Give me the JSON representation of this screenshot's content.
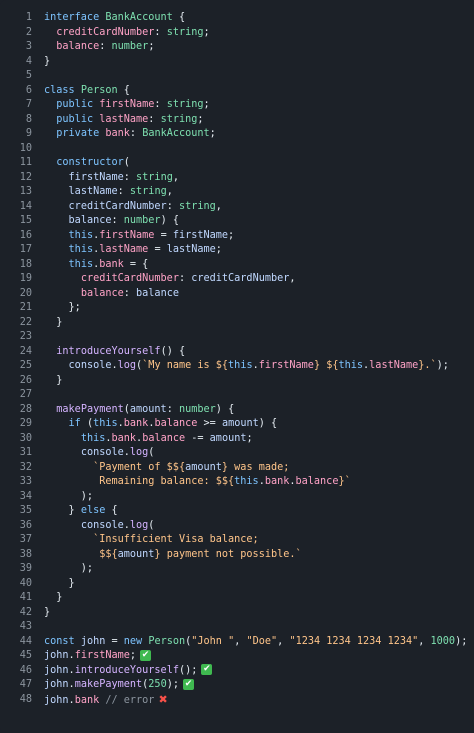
{
  "editor": {
    "lines": [
      [
        {
          "t": "interface ",
          "c": "k"
        },
        {
          "t": "BankAccount",
          "c": "t"
        },
        {
          "t": " {",
          "c": "tx"
        }
      ],
      [
        {
          "t": "  ",
          "c": "tx"
        },
        {
          "t": "creditCardNumber",
          "c": "p"
        },
        {
          "t": ": ",
          "c": "tx"
        },
        {
          "t": "string",
          "c": "t"
        },
        {
          "t": ";",
          "c": "tx"
        }
      ],
      [
        {
          "t": "  ",
          "c": "tx"
        },
        {
          "t": "balance",
          "c": "p"
        },
        {
          "t": ": ",
          "c": "tx"
        },
        {
          "t": "number",
          "c": "t"
        },
        {
          "t": ";",
          "c": "tx"
        }
      ],
      [
        {
          "t": "}",
          "c": "tx"
        }
      ],
      [],
      [
        {
          "t": "class ",
          "c": "k"
        },
        {
          "t": "Person",
          "c": "t"
        },
        {
          "t": " {",
          "c": "tx"
        }
      ],
      [
        {
          "t": "  ",
          "c": "tx"
        },
        {
          "t": "public ",
          "c": "k"
        },
        {
          "t": "firstName",
          "c": "p"
        },
        {
          "t": ": ",
          "c": "tx"
        },
        {
          "t": "string",
          "c": "t"
        },
        {
          "t": ";",
          "c": "tx"
        }
      ],
      [
        {
          "t": "  ",
          "c": "tx"
        },
        {
          "t": "public ",
          "c": "k"
        },
        {
          "t": "lastName",
          "c": "p"
        },
        {
          "t": ": ",
          "c": "tx"
        },
        {
          "t": "string",
          "c": "t"
        },
        {
          "t": ";",
          "c": "tx"
        }
      ],
      [
        {
          "t": "  ",
          "c": "tx"
        },
        {
          "t": "private ",
          "c": "k"
        },
        {
          "t": "bank",
          "c": "p"
        },
        {
          "t": ": ",
          "c": "tx"
        },
        {
          "t": "BankAccount",
          "c": "t"
        },
        {
          "t": ";",
          "c": "tx"
        }
      ],
      [],
      [
        {
          "t": "  ",
          "c": "tx"
        },
        {
          "t": "constructor",
          "c": "k"
        },
        {
          "t": "(",
          "c": "tx"
        }
      ],
      [
        {
          "t": "    ",
          "c": "tx"
        },
        {
          "t": "firstName",
          "c": "v"
        },
        {
          "t": ": ",
          "c": "tx"
        },
        {
          "t": "string",
          "c": "t"
        },
        {
          "t": ",",
          "c": "tx"
        }
      ],
      [
        {
          "t": "    ",
          "c": "tx"
        },
        {
          "t": "lastName",
          "c": "v"
        },
        {
          "t": ": ",
          "c": "tx"
        },
        {
          "t": "string",
          "c": "t"
        },
        {
          "t": ",",
          "c": "tx"
        }
      ],
      [
        {
          "t": "    ",
          "c": "tx"
        },
        {
          "t": "creditCardNumber",
          "c": "v"
        },
        {
          "t": ": ",
          "c": "tx"
        },
        {
          "t": "string",
          "c": "t"
        },
        {
          "t": ",",
          "c": "tx"
        }
      ],
      [
        {
          "t": "    ",
          "c": "tx"
        },
        {
          "t": "balance",
          "c": "v"
        },
        {
          "t": ": ",
          "c": "tx"
        },
        {
          "t": "number",
          "c": "t"
        },
        {
          "t": ") {",
          "c": "tx"
        }
      ],
      [
        {
          "t": "    ",
          "c": "tx"
        },
        {
          "t": "this",
          "c": "k"
        },
        {
          "t": ".",
          "c": "tx"
        },
        {
          "t": "firstName",
          "c": "p"
        },
        {
          "t": " = ",
          "c": "tx"
        },
        {
          "t": "firstName",
          "c": "v"
        },
        {
          "t": ";",
          "c": "tx"
        }
      ],
      [
        {
          "t": "    ",
          "c": "tx"
        },
        {
          "t": "this",
          "c": "k"
        },
        {
          "t": ".",
          "c": "tx"
        },
        {
          "t": "lastName",
          "c": "p"
        },
        {
          "t": " = ",
          "c": "tx"
        },
        {
          "t": "lastName",
          "c": "v"
        },
        {
          "t": ";",
          "c": "tx"
        }
      ],
      [
        {
          "t": "    ",
          "c": "tx"
        },
        {
          "t": "this",
          "c": "k"
        },
        {
          "t": ".",
          "c": "tx"
        },
        {
          "t": "bank",
          "c": "p"
        },
        {
          "t": " = {",
          "c": "tx"
        }
      ],
      [
        {
          "t": "      ",
          "c": "tx"
        },
        {
          "t": "creditCardNumber",
          "c": "p"
        },
        {
          "t": ": ",
          "c": "tx"
        },
        {
          "t": "creditCardNumber",
          "c": "v"
        },
        {
          "t": ",",
          "c": "tx"
        }
      ],
      [
        {
          "t": "      ",
          "c": "tx"
        },
        {
          "t": "balance",
          "c": "p"
        },
        {
          "t": ": ",
          "c": "tx"
        },
        {
          "t": "balance",
          "c": "v"
        }
      ],
      [
        {
          "t": "    };",
          "c": "tx"
        }
      ],
      [
        {
          "t": "  }",
          "c": "tx"
        }
      ],
      [],
      [
        {
          "t": "  ",
          "c": "tx"
        },
        {
          "t": "introduceYourself",
          "c": "f"
        },
        {
          "t": "() {",
          "c": "tx"
        }
      ],
      [
        {
          "t": "    ",
          "c": "tx"
        },
        {
          "t": "console",
          "c": "v"
        },
        {
          "t": ".",
          "c": "tx"
        },
        {
          "t": "log",
          "c": "f"
        },
        {
          "t": "(",
          "c": "tx"
        },
        {
          "t": "`My name is ${",
          "c": "s"
        },
        {
          "t": "this",
          "c": "k"
        },
        {
          "t": ".",
          "c": "tx"
        },
        {
          "t": "firstName",
          "c": "p"
        },
        {
          "t": "} ${",
          "c": "s"
        },
        {
          "t": "this",
          "c": "k"
        },
        {
          "t": ".",
          "c": "tx"
        },
        {
          "t": "lastName",
          "c": "p"
        },
        {
          "t": "}.`",
          "c": "s"
        },
        {
          "t": ");",
          "c": "tx"
        }
      ],
      [
        {
          "t": "  }",
          "c": "tx"
        }
      ],
      [],
      [
        {
          "t": "  ",
          "c": "tx"
        },
        {
          "t": "makePayment",
          "c": "f"
        },
        {
          "t": "(",
          "c": "tx"
        },
        {
          "t": "amount",
          "c": "v"
        },
        {
          "t": ": ",
          "c": "tx"
        },
        {
          "t": "number",
          "c": "t"
        },
        {
          "t": ") {",
          "c": "tx"
        }
      ],
      [
        {
          "t": "    ",
          "c": "tx"
        },
        {
          "t": "if ",
          "c": "k"
        },
        {
          "t": "(",
          "c": "tx"
        },
        {
          "t": "this",
          "c": "k"
        },
        {
          "t": ".",
          "c": "tx"
        },
        {
          "t": "bank",
          "c": "p"
        },
        {
          "t": ".",
          "c": "tx"
        },
        {
          "t": "balance",
          "c": "p"
        },
        {
          "t": " >= ",
          "c": "tx"
        },
        {
          "t": "amount",
          "c": "v"
        },
        {
          "t": ") {",
          "c": "tx"
        }
      ],
      [
        {
          "t": "      ",
          "c": "tx"
        },
        {
          "t": "this",
          "c": "k"
        },
        {
          "t": ".",
          "c": "tx"
        },
        {
          "t": "bank",
          "c": "p"
        },
        {
          "t": ".",
          "c": "tx"
        },
        {
          "t": "balance",
          "c": "p"
        },
        {
          "t": " -= ",
          "c": "tx"
        },
        {
          "t": "amount",
          "c": "v"
        },
        {
          "t": ";",
          "c": "tx"
        }
      ],
      [
        {
          "t": "      ",
          "c": "tx"
        },
        {
          "t": "console",
          "c": "v"
        },
        {
          "t": ".",
          "c": "tx"
        },
        {
          "t": "log",
          "c": "f"
        },
        {
          "t": "(",
          "c": "tx"
        }
      ],
      [
        {
          "t": "        ",
          "c": "tx"
        },
        {
          "t": "`Payment of $${",
          "c": "s"
        },
        {
          "t": "amount",
          "c": "v"
        },
        {
          "t": "} was made;",
          "c": "s"
        }
      ],
      [
        {
          "t": "         ",
          "c": "tx"
        },
        {
          "t": "Remaining balance: $${",
          "c": "s"
        },
        {
          "t": "this",
          "c": "k"
        },
        {
          "t": ".",
          "c": "tx"
        },
        {
          "t": "bank",
          "c": "p"
        },
        {
          "t": ".",
          "c": "tx"
        },
        {
          "t": "balance",
          "c": "p"
        },
        {
          "t": "}`",
          "c": "s"
        }
      ],
      [
        {
          "t": "      );",
          "c": "tx"
        }
      ],
      [
        {
          "t": "    } ",
          "c": "tx"
        },
        {
          "t": "else",
          "c": "k"
        },
        {
          "t": " {",
          "c": "tx"
        }
      ],
      [
        {
          "t": "      ",
          "c": "tx"
        },
        {
          "t": "console",
          "c": "v"
        },
        {
          "t": ".",
          "c": "tx"
        },
        {
          "t": "log",
          "c": "f"
        },
        {
          "t": "(",
          "c": "tx"
        }
      ],
      [
        {
          "t": "        ",
          "c": "tx"
        },
        {
          "t": "`Insufficient Visa balance;",
          "c": "s"
        }
      ],
      [
        {
          "t": "         ",
          "c": "tx"
        },
        {
          "t": "$${",
          "c": "s"
        },
        {
          "t": "amount",
          "c": "v"
        },
        {
          "t": "} payment not possible.`",
          "c": "s"
        }
      ],
      [
        {
          "t": "      );",
          "c": "tx"
        }
      ],
      [
        {
          "t": "    }",
          "c": "tx"
        }
      ],
      [
        {
          "t": "  }",
          "c": "tx"
        }
      ],
      [
        {
          "t": "}",
          "c": "tx"
        }
      ],
      [],
      [
        {
          "t": "const ",
          "c": "k"
        },
        {
          "t": "john",
          "c": "v"
        },
        {
          "t": " = ",
          "c": "tx"
        },
        {
          "t": "new ",
          "c": "k"
        },
        {
          "t": "Person",
          "c": "t"
        },
        {
          "t": "(",
          "c": "tx"
        },
        {
          "t": "\"John \"",
          "c": "s"
        },
        {
          "t": ", ",
          "c": "tx"
        },
        {
          "t": "\"Doe\"",
          "c": "s"
        },
        {
          "t": ", ",
          "c": "tx"
        },
        {
          "t": "\"1234 1234 1234 1234\"",
          "c": "s"
        },
        {
          "t": ", ",
          "c": "tx"
        },
        {
          "t": "1000",
          "c": "t"
        },
        {
          "t": ");",
          "c": "tx"
        }
      ],
      [
        {
          "t": "john",
          "c": "v"
        },
        {
          "t": ".",
          "c": "tx"
        },
        {
          "t": "firstName",
          "c": "p"
        },
        {
          "t": ";",
          "c": "tx"
        },
        {
          "icon": "check-mark-icon",
          "t": "✔"
        }
      ],
      [
        {
          "t": "john",
          "c": "v"
        },
        {
          "t": ".",
          "c": "tx"
        },
        {
          "t": "introduceYourself",
          "c": "f"
        },
        {
          "t": "();",
          "c": "tx"
        },
        {
          "icon": "check-mark-icon",
          "t": "✔"
        }
      ],
      [
        {
          "t": "john",
          "c": "v"
        },
        {
          "t": ".",
          "c": "tx"
        },
        {
          "t": "makePayment",
          "c": "f"
        },
        {
          "t": "(",
          "c": "tx"
        },
        {
          "t": "250",
          "c": "t"
        },
        {
          "t": ");",
          "c": "tx"
        },
        {
          "icon": "check-mark-icon",
          "t": "✔"
        }
      ],
      [
        {
          "t": "john",
          "c": "v"
        },
        {
          "t": ".",
          "c": "tx"
        },
        {
          "t": "bank",
          "c": "p"
        },
        {
          "t": " ",
          "c": "tx"
        },
        {
          "t": "// error",
          "c": "c"
        },
        {
          "icon": "cross-mark-icon",
          "t": "✖"
        }
      ]
    ]
  },
  "colors": {
    "background": "#1c2128",
    "success": "#3fb950",
    "error": "#f85149"
  }
}
